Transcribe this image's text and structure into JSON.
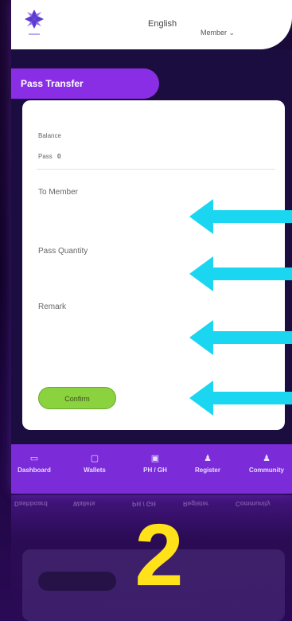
{
  "header": {
    "language": "English",
    "member_menu": "Member ⌄"
  },
  "page": {
    "title": "Pass Transfer"
  },
  "form": {
    "balance_label": "Balance",
    "pass_label": "Pass",
    "pass_value": "0",
    "to_member_label": "To Member",
    "pass_quantity_label": "Pass Quantity",
    "remark_label": "Remark",
    "confirm_label": "Confirm"
  },
  "nav": {
    "items": [
      {
        "label": "Dashboard",
        "icon": "dashboard-icon"
      },
      {
        "label": "Wallets",
        "icon": "wallet-icon"
      },
      {
        "label": "PH / GH",
        "icon": "ph-gh-icon"
      },
      {
        "label": "Register",
        "icon": "register-user-icon"
      },
      {
        "label": "Community",
        "icon": "community-icon"
      }
    ]
  },
  "annotation": {
    "step_number": "2",
    "arrow_color": "#1ad6f0"
  },
  "colors": {
    "accent_purple": "#8a2ee6",
    "confirm_green": "#8bd23f",
    "step_yellow": "#ffe21a"
  }
}
